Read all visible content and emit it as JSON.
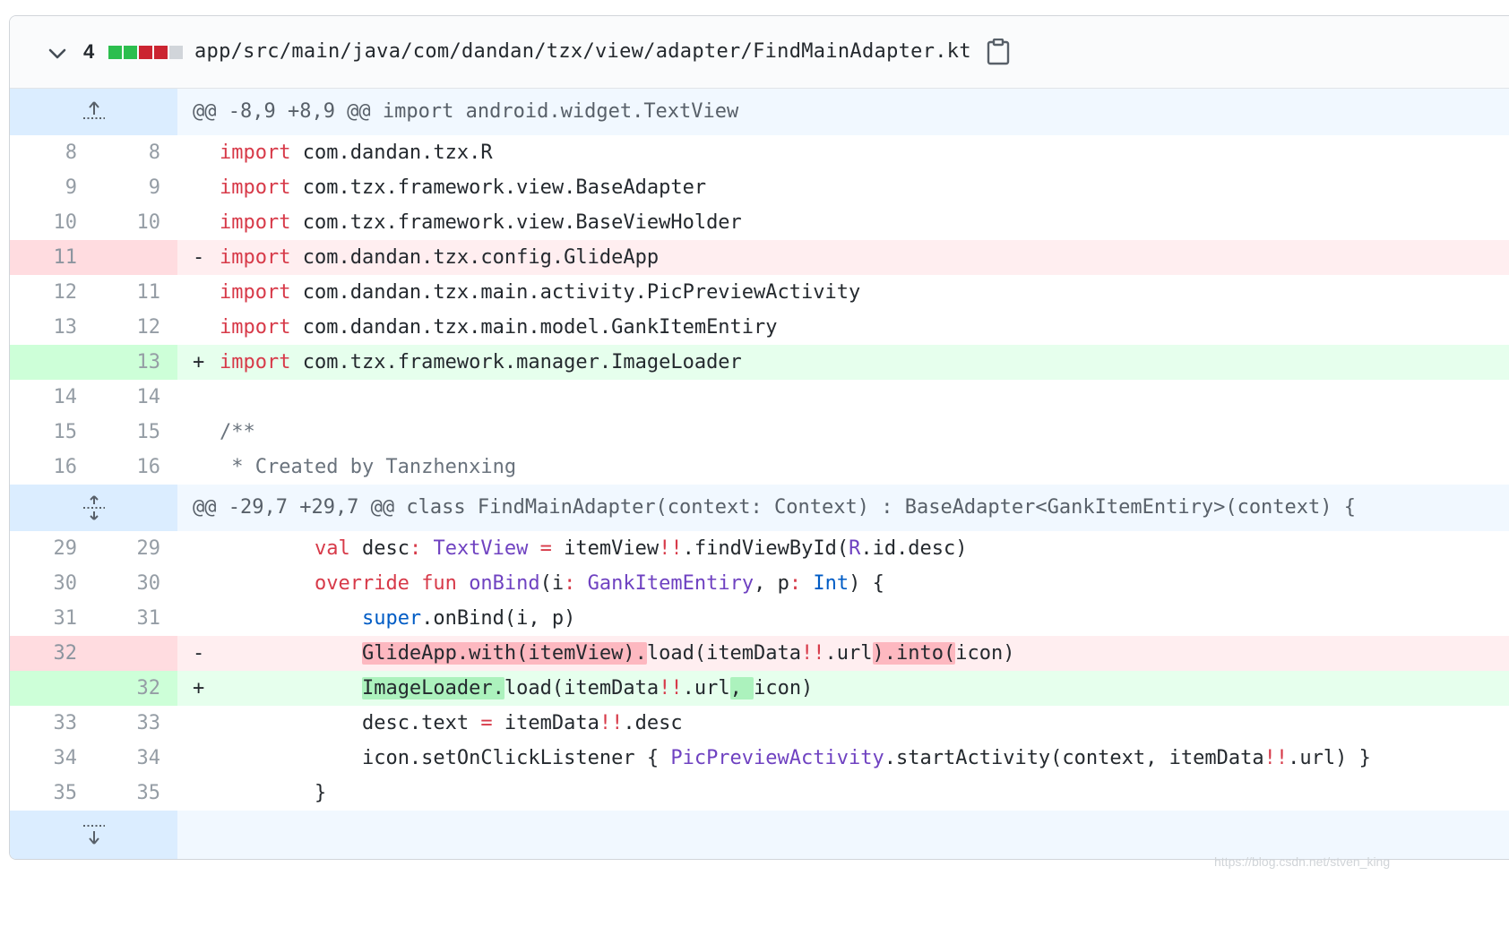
{
  "file": {
    "diff_count": "4",
    "diffstat_colors": [
      "#2cbe4e",
      "#2cbe4e",
      "#cb2431",
      "#cb2431",
      "#d1d5da"
    ],
    "path": "app/src/main/java/com/dandan/tzx/view/adapter/FindMainAdapter.kt",
    "icons": {
      "collapse": "chevron-down-icon",
      "copy": "clipboard-icon"
    }
  },
  "hunks": [
    {
      "header": "@@ -8,9 +8,9 @@ import android.widget.TextView",
      "icon": "expand-up-icon"
    },
    {
      "header": "@@ -29,7 +29,7 @@ class FindMainAdapter(context: Context) : BaseAdapter<GankItemEntiry>(context) {",
      "icon": "expand-both-icon"
    },
    {
      "header": "",
      "icon": "expand-down-icon"
    }
  ],
  "lines": [
    {
      "old": "8",
      "new": "8",
      "sign": " "
    },
    {
      "old": "9",
      "new": "9",
      "sign": " "
    },
    {
      "old": "10",
      "new": "10",
      "sign": " "
    },
    {
      "old": "11",
      "new": "",
      "sign": "-"
    },
    {
      "old": "12",
      "new": "11",
      "sign": " "
    },
    {
      "old": "13",
      "new": "12",
      "sign": " "
    },
    {
      "old": "",
      "new": "13",
      "sign": "+"
    },
    {
      "old": "14",
      "new": "14",
      "sign": " "
    },
    {
      "old": "15",
      "new": "15",
      "sign": " "
    },
    {
      "old": "16",
      "new": "16",
      "sign": " "
    },
    {
      "old": "29",
      "new": "29",
      "sign": " "
    },
    {
      "old": "30",
      "new": "30",
      "sign": " "
    },
    {
      "old": "31",
      "new": "31",
      "sign": " "
    },
    {
      "old": "32",
      "new": "",
      "sign": "-"
    },
    {
      "old": "",
      "new": "32",
      "sign": "+"
    },
    {
      "old": "33",
      "new": "33",
      "sign": " "
    },
    {
      "old": "34",
      "new": "34",
      "sign": " "
    },
    {
      "old": "35",
      "new": "35",
      "sign": " "
    }
  ],
  "tokens": {
    "import": "import",
    "l1": " com.dandan.tzx.R",
    "l2": " com.tzx.framework.view.BaseAdapter",
    "l3": " com.tzx.framework.view.BaseViewHolder",
    "l4": " com.dandan.tzx.config.GlideApp",
    "l5": " com.dandan.tzx.main.activity.PicPreviewActivity",
    "l6": " com.dandan.tzx.main.model.GankItemEntiry",
    "l7": " com.tzx.framework.manager.ImageLoader",
    "c1": "/**",
    "c2": " * Created by Tanzhenxing",
    "indent8": "        ",
    "indent12": "            ",
    "val": "val",
    "desc_decl": " desc",
    "colon": ":",
    "sp": " ",
    "TextView": "TextView",
    "eq": " = ",
    "itemView": "itemView",
    "bang": "!!",
    "findViewById": ".findViewById(",
    "R": "R",
    "id_desc": ".id.desc)",
    "override": "override",
    "fun": "fun",
    "onBind": "onBind",
    "paren_i": "(i",
    "GankItemEntiry": "GankItemEntiry",
    "comma_p": ", p",
    "Int": "Int",
    "close_brace_open": ") {",
    "super": "super",
    "super_rest": ".onBind(i, p)",
    "del_hl1": "GlideApp.with(itemView).",
    "load_itemData": "load(itemData",
    "dot_url": ".url",
    "del_hl2": ").into(",
    "icon_close": "icon)",
    "add_hl1": "ImageLoader.",
    "add_hl2": ", ",
    "desc_text": "desc.text",
    "itemData": "itemData",
    "dot_desc": ".desc",
    "icon_set": "icon.setOnClickListener { ",
    "PicPreviewActivity": "PicPreviewActivity",
    "start_ctx": ".startActivity(context, itemData",
    "url_end": ".url) }",
    "close_brace": "}"
  },
  "watermark": "https://blog.csdn.net/stven_king"
}
